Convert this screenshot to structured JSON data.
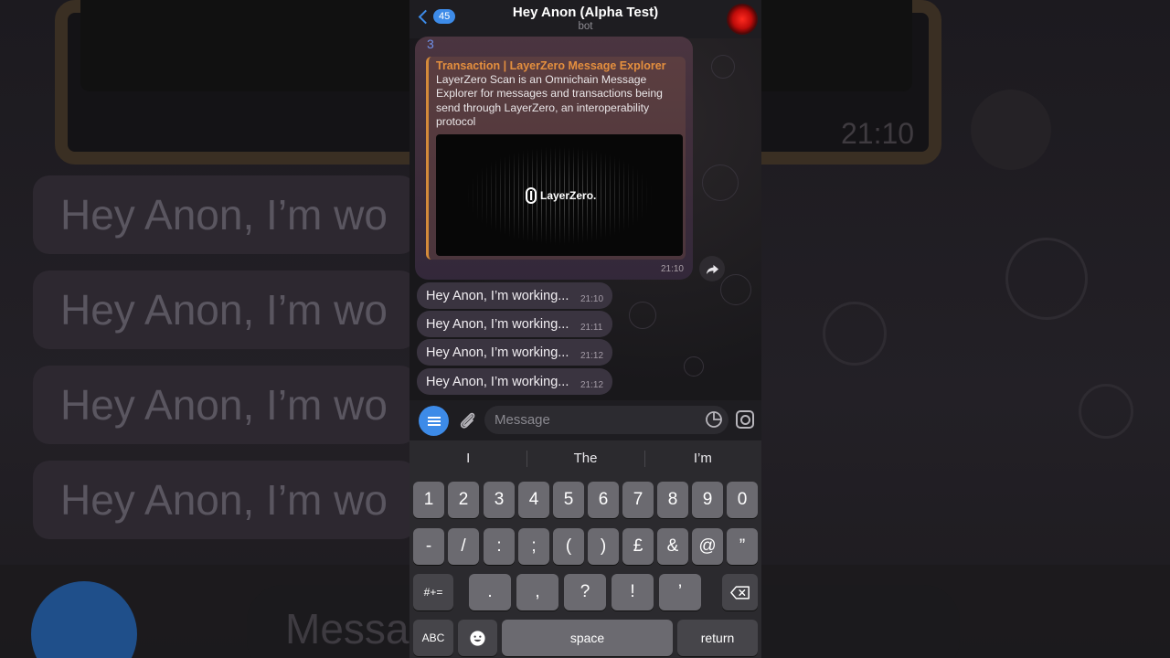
{
  "background": {
    "bubble_text": "Hey Anon, I’m wo",
    "input_placeholder": "Messa",
    "time": "21:10"
  },
  "header": {
    "back_count": "45",
    "title": "Hey Anon (Alpha Test)",
    "subtitle": "bot"
  },
  "link_message": {
    "text": "3",
    "preview_title": "Transaction | LayerZero Message Explorer",
    "preview_description": "LayerZero Scan is an Omnichain Message Explorer for messages and transactions being send through LayerZero, an interoperability protocol",
    "image_logo_text": "LayerZero.",
    "time": "21:10"
  },
  "messages": [
    {
      "text": "Hey Anon, I’m working...",
      "time": "21:10"
    },
    {
      "text": "Hey Anon, I’m working...",
      "time": "21:11"
    },
    {
      "text": "Hey Anon, I’m working...",
      "time": "21:12"
    },
    {
      "text": "Hey Anon, I’m working...",
      "time": "21:12"
    }
  ],
  "input": {
    "placeholder": "Message"
  },
  "keyboard": {
    "suggestions": [
      "I",
      "The",
      "I’m"
    ],
    "row1": [
      "1",
      "2",
      "3",
      "4",
      "5",
      "6",
      "7",
      "8",
      "9",
      "0"
    ],
    "row2": [
      "-",
      "/",
      ":",
      ";",
      "(",
      ")",
      "£",
      "&",
      "@",
      "”"
    ],
    "row3": [
      ".",
      ",",
      "?",
      "!",
      "’"
    ],
    "symbols_key": "#+=",
    "abc_key": "ABC",
    "space_key": "space",
    "return_key": "return"
  },
  "colors": {
    "accent": "#3d8be8",
    "preview_accent": "#e48f3e"
  }
}
